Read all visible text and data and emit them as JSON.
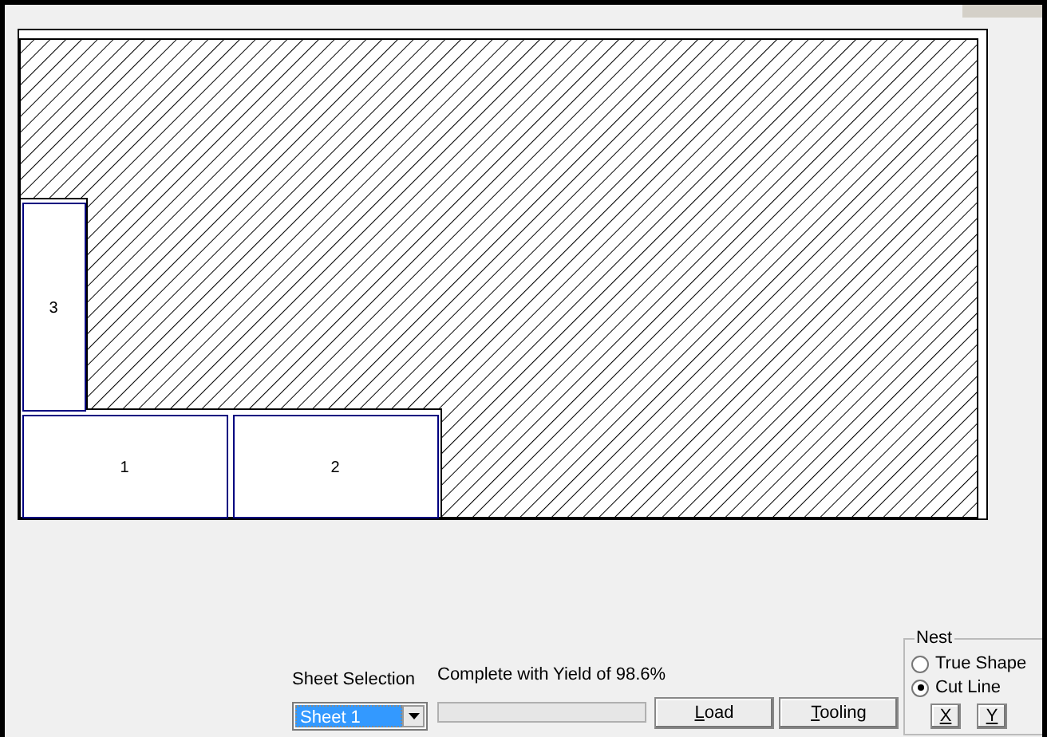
{
  "parts": [
    {
      "label": "3"
    },
    {
      "label": "1"
    },
    {
      "label": "2"
    }
  ],
  "sheet_selection": {
    "label": "Sheet Selection",
    "value": "Sheet 1"
  },
  "status": "Complete with Yield of 98.6%",
  "buttons": [
    {
      "label": "Load"
    },
    {
      "label": "Tooling"
    }
  ],
  "nest": {
    "title": "Nest",
    "options": [
      {
        "label": "True Shape",
        "selected": false
      },
      {
        "label": "Cut Line",
        "selected": true
      }
    ],
    "axis_buttons": [
      "X",
      "Y"
    ]
  }
}
